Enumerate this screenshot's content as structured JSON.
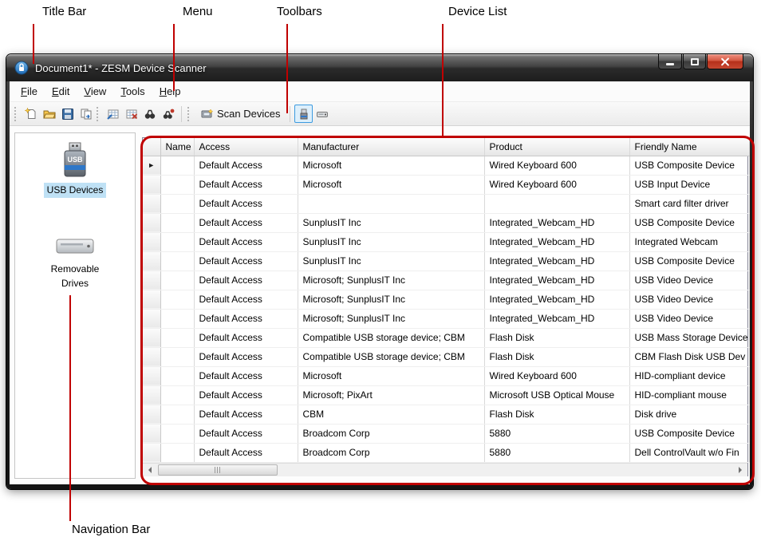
{
  "annotations": {
    "title_bar": "Title Bar",
    "menu": "Menu",
    "toolbars": "Toolbars",
    "device_list": "Device List",
    "navigation_bar": "Navigation Bar"
  },
  "window": {
    "title": "Document1* - ZESM Device Scanner",
    "icon": "lock-shield-icon"
  },
  "menubar": {
    "items": [
      {
        "label": "File",
        "u": "F",
        "rest": "ile"
      },
      {
        "label": "Edit",
        "u": "E",
        "rest": "dit"
      },
      {
        "label": "View",
        "u": "V",
        "rest": "iew"
      },
      {
        "label": "Tools",
        "u": "T",
        "rest": "ools"
      },
      {
        "label": "Help",
        "u": "H",
        "rest": "elp"
      }
    ]
  },
  "toolbar": {
    "buttons": [
      {
        "name": "new-document"
      },
      {
        "name": "open"
      },
      {
        "name": "save"
      },
      {
        "name": "export"
      },
      {
        "name": "import-table"
      },
      {
        "name": "delete-table"
      },
      {
        "name": "find"
      },
      {
        "name": "find-next"
      }
    ],
    "scan_devices_label": "Scan Devices",
    "view_toggles": [
      {
        "name": "usb-devices-view",
        "selected": true
      },
      {
        "name": "removable-drives-view",
        "selected": false
      }
    ]
  },
  "sidebar": {
    "usb_icon_text": "USB",
    "items": [
      {
        "label": "USB Devices",
        "selected": true,
        "icon": "usb-device-icon"
      },
      {
        "label": "Removable Drives",
        "selected": false,
        "icon": "removable-drive-icon"
      }
    ]
  },
  "grid": {
    "row_marker_glyph": "►",
    "columns": [
      "Name",
      "Access",
      "Manufacturer",
      "Product",
      "Friendly Name"
    ],
    "rows": [
      {
        "selected": true,
        "name": "",
        "access": "Default Access",
        "manufacturer": "Microsoft",
        "product": "Wired Keyboard 600",
        "friendly_name": "USB Composite Device"
      },
      {
        "name": "",
        "access": "Default Access",
        "manufacturer": "Microsoft",
        "product": "Wired Keyboard 600",
        "friendly_name": "USB Input Device"
      },
      {
        "name": "",
        "access": "Default Access",
        "manufacturer": "",
        "product": "",
        "friendly_name": "Smart card filter driver"
      },
      {
        "name": "",
        "access": "Default Access",
        "manufacturer": "SunplusIT Inc",
        "product": "Integrated_Webcam_HD",
        "friendly_name": "USB Composite Device"
      },
      {
        "name": "",
        "access": "Default Access",
        "manufacturer": "SunplusIT Inc",
        "product": "Integrated_Webcam_HD",
        "friendly_name": "Integrated Webcam"
      },
      {
        "name": "",
        "access": "Default Access",
        "manufacturer": "SunplusIT Inc",
        "product": "Integrated_Webcam_HD",
        "friendly_name": "USB Composite Device"
      },
      {
        "name": "",
        "access": "Default Access",
        "manufacturer": "Microsoft; SunplusIT Inc",
        "product": "Integrated_Webcam_HD",
        "friendly_name": "USB Video Device"
      },
      {
        "name": "",
        "access": "Default Access",
        "manufacturer": "Microsoft; SunplusIT Inc",
        "product": "Integrated_Webcam_HD",
        "friendly_name": "USB Video Device"
      },
      {
        "name": "",
        "access": "Default Access",
        "manufacturer": "Microsoft; SunplusIT Inc",
        "product": "Integrated_Webcam_HD",
        "friendly_name": "USB Video Device"
      },
      {
        "name": "",
        "access": "Default Access",
        "manufacturer": "Compatible USB storage device; CBM",
        "product": "Flash Disk",
        "friendly_name": "USB Mass Storage Device"
      },
      {
        "name": "",
        "access": "Default Access",
        "manufacturer": "Compatible USB storage device; CBM",
        "product": "Flash Disk",
        "friendly_name": "CBM Flash Disk USB Dev"
      },
      {
        "name": "",
        "access": "Default Access",
        "manufacturer": "Microsoft",
        "product": "Wired Keyboard 600",
        "friendly_name": "HID-compliant device"
      },
      {
        "name": "",
        "access": "Default Access",
        "manufacturer": "Microsoft; PixArt",
        "product": "Microsoft USB Optical Mouse",
        "friendly_name": "HID-compliant mouse"
      },
      {
        "name": "",
        "access": "Default Access",
        "manufacturer": "CBM",
        "product": "Flash Disk",
        "friendly_name": "Disk drive"
      },
      {
        "name": "",
        "access": "Default Access",
        "manufacturer": "Broadcom Corp",
        "product": "5880",
        "friendly_name": "USB Composite Device"
      },
      {
        "name": "",
        "access": "Default Access",
        "manufacturer": "Broadcom Corp",
        "product": "5880",
        "friendly_name": "Dell ControlVault w/o Fin"
      }
    ]
  },
  "colors": {
    "annotation_red": "#c00000",
    "selection_blue": "#bfe1f5",
    "close_button_red": "#c64730"
  }
}
